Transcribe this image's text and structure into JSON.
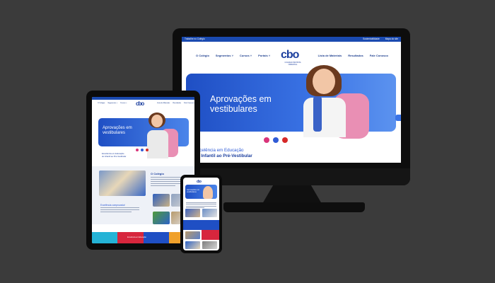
{
  "site": {
    "logo_text": "cbo",
    "logo_subtitle": "COLÉGIO BATISTA ORIENTAL",
    "topbar_left": "Trabalhe no Colégio",
    "topbar_right": [
      "Sustentabilidade",
      "Mapa do site"
    ],
    "nav_left": [
      "O Colégio",
      "Segmentos ˅",
      "Cursos ˅",
      "Portais ˅"
    ],
    "nav_right": [
      "Lista de Materiais",
      "Resultados",
      "Fale Conosco"
    ],
    "hero_title": "Aprovações em vestibulares",
    "welcome_line1": "Excelência em Educação",
    "welcome_line2": "do Infantil ao Pré-Vestibular",
    "section_title": "O Colégio",
    "reason_title": "Excelência comprovada!",
    "card_label": "Excelência em Educação"
  },
  "colors": {
    "brand_blue": "#1c3f9e",
    "hero_blue": "#2d5ad6",
    "instagram": "#d9347a",
    "facebook": "#2f5bd6",
    "youtube": "#d62828",
    "accent_orange": "#f0a12b",
    "card_colors": [
      "#24b3d6",
      "#d7263d",
      "#1f4fc4",
      "#f0a12b"
    ]
  },
  "icons": [
    "instagram-icon",
    "facebook-icon",
    "youtube-icon",
    "chat-icon"
  ]
}
